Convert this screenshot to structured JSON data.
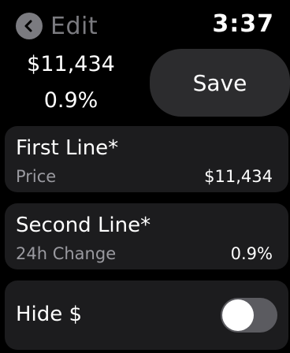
{
  "header": {
    "back_label": "Edit",
    "time": "3:37"
  },
  "preview": {
    "value": "$11,434",
    "change": "0.9%"
  },
  "save_label": "Save",
  "first_line": {
    "title": "First Line*",
    "sub": "Price",
    "value": "$11,434"
  },
  "second_line": {
    "title": "Second Line*",
    "sub": "24h Change",
    "value": "0.9%"
  },
  "hide_dollar": {
    "label": "Hide $",
    "enabled": false
  },
  "colors": {
    "background": "#000000",
    "card": "#1c1c1e",
    "muted": "#7b7b80",
    "toggle_off": "#5b5b60"
  },
  "icons": {
    "back": "chevron-left-icon"
  }
}
